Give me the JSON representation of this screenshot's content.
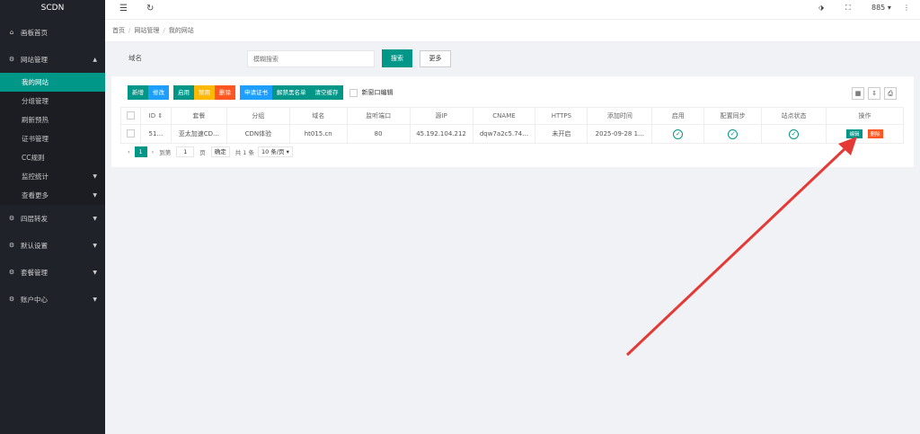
{
  "app": {
    "logo": "SCDN"
  },
  "sidebar": {
    "items": [
      {
        "label": "画板首页",
        "icon": "home-icon"
      },
      {
        "label": "网站管理",
        "icon": "gear-icon",
        "arrow": "▲"
      }
    ],
    "sub_items": [
      {
        "label": "我的网站"
      },
      {
        "label": "分组管理"
      },
      {
        "label": "刷新预热"
      },
      {
        "label": "证书管理"
      },
      {
        "label": "CC规则"
      },
      {
        "label": "监控统计",
        "arrow": "▼"
      },
      {
        "label": "查看更多",
        "arrow": "▼"
      }
    ],
    "items_bottom": [
      {
        "label": "四层转发",
        "arrow": "▼"
      },
      {
        "label": "默认设置",
        "arrow": "▼"
      },
      {
        "label": "套餐管理",
        "arrow": "▼"
      },
      {
        "label": "账户中心",
        "arrow": "▼"
      }
    ]
  },
  "header": {
    "menu_icon": "☰",
    "refresh_icon": "↻",
    "tag_icon": "⬗",
    "fullscreen_icon": "⛶",
    "user": "885 ▾",
    "more_icon": "⋮"
  },
  "breadcrumb": {
    "items": [
      "首页",
      "网站管理",
      "我的网站"
    ],
    "sep": "/"
  },
  "search": {
    "label": "域名",
    "placeholder": "模糊搜索",
    "search_btn": "搜索",
    "more_btn": "更多"
  },
  "toolbar": {
    "add": "新增",
    "edit": "修改",
    "enable": "启用",
    "disable": "禁用",
    "delete": "删除",
    "apply_cert": "申请证书",
    "unblock": "解禁黑名单",
    "clear_cache": "清空缓存",
    "new_window": "新窗口编辑"
  },
  "tools_right": [
    "▦",
    "⇩",
    "⎙"
  ],
  "table": {
    "headers": [
      "ID ⇕",
      "套餐",
      "分组",
      "域名",
      "监听端口",
      "源IP",
      "CNAME",
      "HTTPS",
      "添加时间",
      "启用",
      "配置同步",
      "站点状态",
      "操作"
    ],
    "row": [
      "51…",
      "亚太加速CD…",
      "CDN体验",
      "ht015.cn",
      "80",
      "45.192.104.212",
      "dqw7a2c5.74…",
      "未开启",
      "2025-09-28 1…"
    ],
    "check": "✓",
    "edit": "编辑",
    "delete": "删除"
  },
  "pager": {
    "prev": "‹",
    "page": "1",
    "next": "›",
    "goto": "到第",
    "input": "1",
    "page_unit": "页",
    "confirm": "确定",
    "total": "共 1 条",
    "per_page": "10 条/页 ▾"
  },
  "colors": {
    "accent": "#009688",
    "blue": "#1e9fff",
    "orange": "#ffb800",
    "red": "#ff5722",
    "arrow": "#e53935"
  }
}
